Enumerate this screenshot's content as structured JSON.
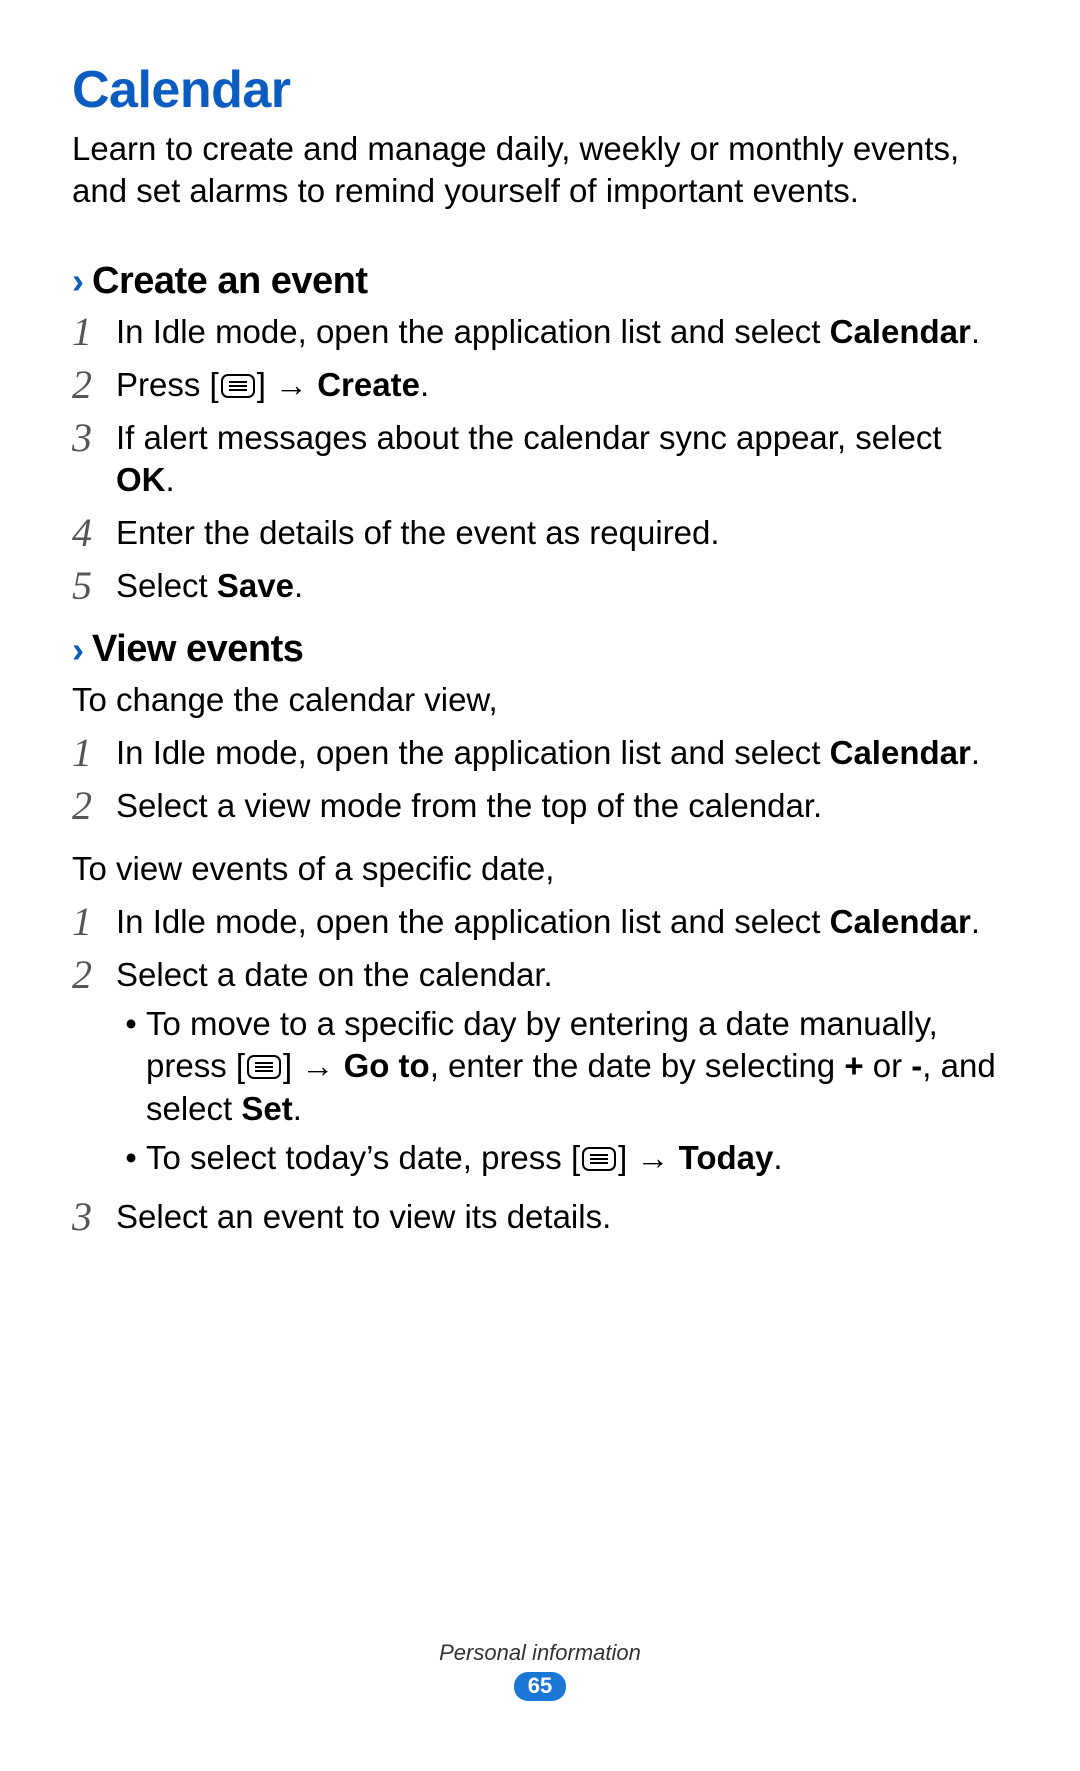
{
  "title": "Calendar",
  "intro": "Learn to create and manage daily, weekly or monthly events, and set alarms to remind yourself of important events.",
  "sections": {
    "create": {
      "heading": "Create an event",
      "steps": {
        "s1a": "In Idle mode, open the application list and select ",
        "s1b": "Calendar",
        "s1c": ".",
        "s2a": "Press [",
        "s2b": "] → ",
        "s2c": "Create",
        "s2d": ".",
        "s3a": "If alert messages about the calendar sync appear, select ",
        "s3b": "OK",
        "s3c": ".",
        "s4": "Enter the details of the event as required.",
        "s5a": "Select ",
        "s5b": "Save",
        "s5c": "."
      }
    },
    "view": {
      "heading": "View events",
      "lead1": "To change the calendar view,",
      "steps1": {
        "s1a": "In Idle mode, open the application list and select ",
        "s1b": "Calendar",
        "s1c": ".",
        "s2": "Select a view mode from the top of the calendar."
      },
      "lead2": "To view events of a specific date,",
      "steps2": {
        "s1a": "In Idle mode, open the application list and select ",
        "s1b": "Calendar",
        "s1c": ".",
        "s2": "Select a date on the calendar.",
        "b1a": "To move to a specific day by entering a date manually, press [",
        "b1b": "] → ",
        "b1c": "Go to",
        "b1d": ", enter the date by selecting ",
        "b1e": "+",
        "b1f": " or ",
        "b1g": "-",
        "b1h": ", and select ",
        "b1i": "Set",
        "b1j": ".",
        "b2a": "To select today’s date, press [",
        "b2b": "] → ",
        "b2c": "Today",
        "b2d": ".",
        "s3": "Select an event to view its details."
      }
    }
  },
  "footer": {
    "section_label": "Personal information",
    "page_number": "65"
  },
  "bullet_char": "•"
}
